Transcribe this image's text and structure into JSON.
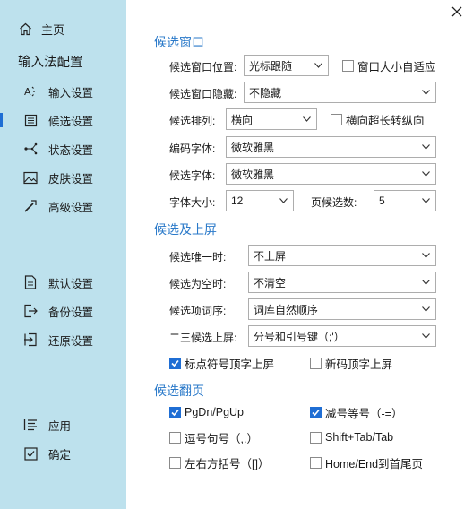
{
  "sidebar": {
    "home_label": "主页",
    "section_title": "输入法配置",
    "items": [
      {
        "label": "输入设置",
        "icon": "text-settings-icon"
      },
      {
        "label": "候选设置",
        "icon": "candidate-list-icon",
        "active": true
      },
      {
        "label": "状态设置",
        "icon": "status-nodes-icon"
      },
      {
        "label": "皮肤设置",
        "icon": "image-icon"
      },
      {
        "label": "高级设置",
        "icon": "wand-icon"
      }
    ],
    "actions": [
      {
        "label": "默认设置",
        "icon": "document-icon"
      },
      {
        "label": "备份设置",
        "icon": "export-icon"
      },
      {
        "label": "还原设置",
        "icon": "import-icon"
      }
    ],
    "apply_label": "应用",
    "ok_label": "确定"
  },
  "accent_color": "#2a79c9",
  "sidebar_color": "#bde1ed",
  "candidate_window": {
    "title": "候选窗口",
    "position_label": "候选窗口位置:",
    "position_value": "光标跟随",
    "autofit_label": "窗口大小自适应",
    "autofit_checked": false,
    "hide_label": "候选窗口隐藏:",
    "hide_value": "不隐藏",
    "arrange_label": "候选排列:",
    "arrange_value": "横向",
    "long_vertical_label": "横向超长转纵向",
    "long_vertical_checked": false,
    "code_font_label": "编码字体:",
    "code_font_value": "微软雅黑",
    "cand_font_label": "候选字体:",
    "cand_font_value": "微软雅黑",
    "font_size_label": "字体大小:",
    "font_size_value": "12",
    "per_page_label": "页候选数:",
    "per_page_value": "5"
  },
  "candidate_commit": {
    "title": "候选及上屏",
    "unique_label": "候选唯一时:",
    "unique_value": "不上屏",
    "empty_label": "候选为空时:",
    "empty_value": "不清空",
    "order_label": "候选项词序:",
    "order_value": "词库自然顺序",
    "second_third_label": "二三候选上屏:",
    "second_third_value": "分号和引号键（;'）",
    "punct_commit_label": "标点符号顶字上屏",
    "punct_commit_checked": true,
    "new_code_label": "新码顶字上屏",
    "new_code_checked": false
  },
  "paging": {
    "title": "候选翻页",
    "keys": [
      {
        "label": "PgDn/PgUp",
        "checked": true
      },
      {
        "label": "减号等号（-=）",
        "checked": true
      },
      {
        "label": "逗号句号（,.）",
        "checked": false
      },
      {
        "label": "Shift+Tab/Tab",
        "checked": false
      },
      {
        "label": "左右方括号（[]）",
        "checked": false
      },
      {
        "label": "Home/End到首尾页",
        "checked": false
      }
    ]
  }
}
